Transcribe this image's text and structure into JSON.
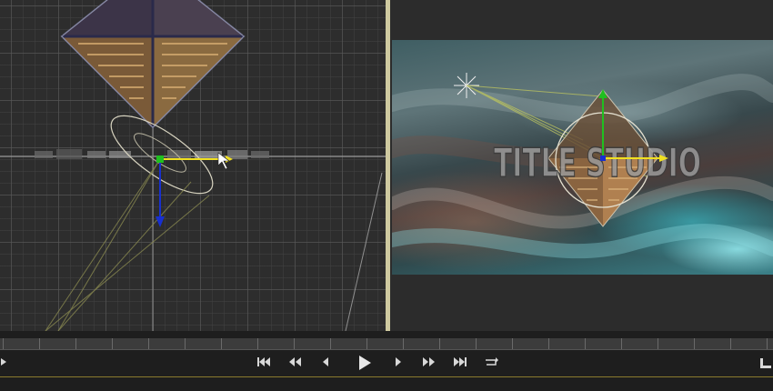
{
  "preview": {
    "title_text": "TITLE STUDIO"
  },
  "transport": {
    "buttons": [
      {
        "name": "go-to-start-button",
        "icon": "skip-to-start-icon"
      },
      {
        "name": "rewind-button",
        "icon": "rewind-icon"
      },
      {
        "name": "step-back-button",
        "icon": "step-back-icon"
      },
      {
        "name": "play-button",
        "icon": "play-icon"
      },
      {
        "name": "step-forward-button",
        "icon": "step-forward-icon"
      },
      {
        "name": "fast-forward-button",
        "icon": "fast-forward-icon"
      },
      {
        "name": "go-to-end-button",
        "icon": "skip-to-end-icon"
      },
      {
        "name": "loop-button",
        "icon": "loop-icon"
      }
    ]
  },
  "colors": {
    "viewport_bg": "#2d2d2d",
    "divider": "#cfcaa0",
    "gizmo_x": "#f0e020",
    "gizmo_y": "#20c020",
    "gizmo_z": "#1830d0",
    "gold_accent": "#8a7a2e"
  }
}
